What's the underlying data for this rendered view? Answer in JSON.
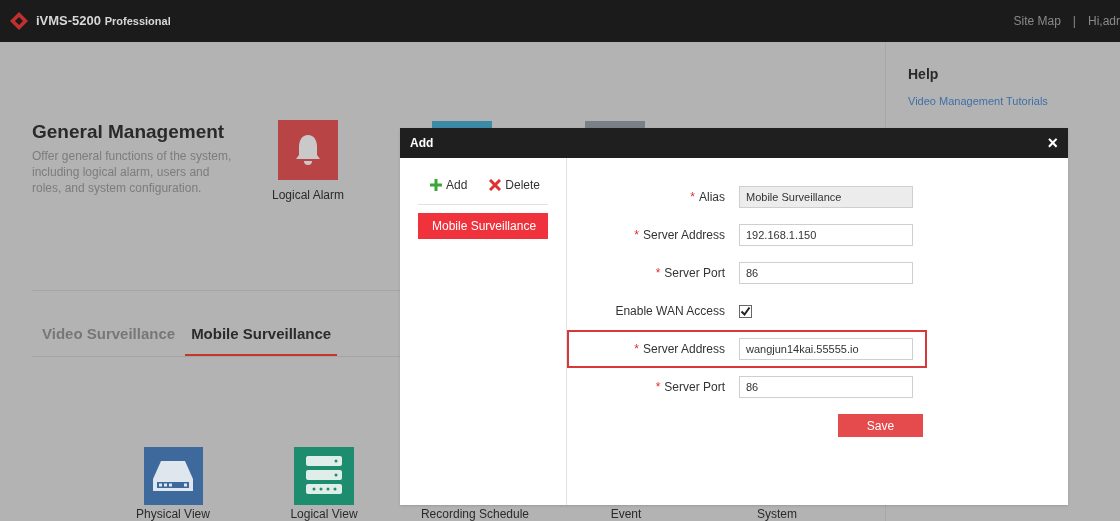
{
  "app": {
    "name": "iVMS-5200",
    "edition": "Professional"
  },
  "header": {
    "links": [
      {
        "label": "Site Map"
      },
      {
        "label": "Hi,adr"
      }
    ],
    "separator": "|"
  },
  "general": {
    "title": "General Management",
    "description": "Offer general functions of the system, including logical alarm, users and roles, and system configuration.",
    "tiles": [
      {
        "label": "Logical Alarm",
        "kind": "bell"
      }
    ]
  },
  "tabs": [
    {
      "label": "Video Surveillance",
      "selected": false
    },
    {
      "label": "Mobile Surveillance",
      "selected": true
    }
  ],
  "modules": [
    {
      "label": "Physical View",
      "kind": "drive"
    },
    {
      "label": "Logical View",
      "kind": "server"
    },
    {
      "label": "Recording Schedule"
    },
    {
      "label": "Event"
    },
    {
      "label": "System"
    }
  ],
  "help": {
    "title": "Help",
    "links": [
      "Video Management Tutorials"
    ]
  },
  "dialog": {
    "title": "Add",
    "close": "×",
    "toolbar": [
      {
        "label": "Add",
        "kind": "plus"
      },
      {
        "label": "Delete",
        "kind": "cross"
      }
    ],
    "list": [
      {
        "label": "Mobile Surveillance",
        "selected": true
      }
    ],
    "fields": [
      {
        "kind": "input",
        "required_mark": "*",
        "label": "Alias",
        "value": "Mobile Surveillance",
        "disabled": true,
        "highlighted": false
      },
      {
        "kind": "input",
        "required_mark": "*",
        "label": "Server Address",
        "value": "192.168.1.150",
        "disabled": false,
        "highlighted": false
      },
      {
        "kind": "input",
        "required_mark": "*",
        "label": "Server Port",
        "value": "86",
        "disabled": false,
        "highlighted": false
      },
      {
        "kind": "checkbox",
        "label": "Enable WAN Access",
        "checked": true,
        "highlighted": false
      },
      {
        "kind": "input",
        "required_mark": "*",
        "label": "Server Address",
        "value": "wangjun14kai.55555.io",
        "disabled": false,
        "highlighted": true
      },
      {
        "kind": "input",
        "required_mark": "*",
        "label": "Server Port",
        "value": "86",
        "disabled": false,
        "highlighted": false
      }
    ],
    "save": "Save"
  }
}
